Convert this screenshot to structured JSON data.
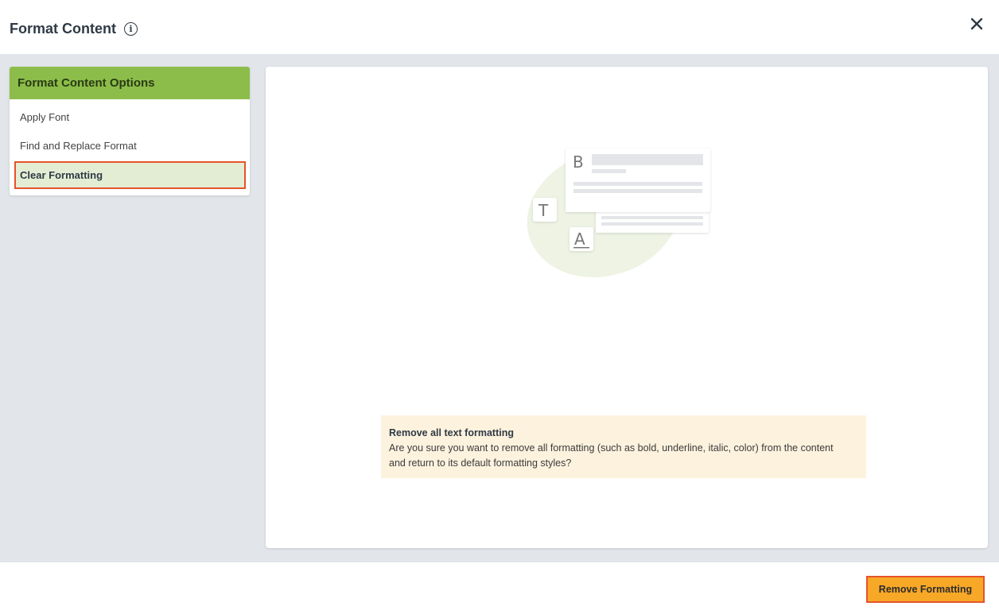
{
  "dialog": {
    "title": "Format Content",
    "info_icon": "info-circle-icon",
    "close_icon": "close-icon"
  },
  "sidebar": {
    "header": "Format Content Options",
    "items": [
      {
        "label": "Apply Font",
        "selected": false
      },
      {
        "label": "Find and Replace Format",
        "selected": false
      },
      {
        "label": "Clear Formatting",
        "selected": true
      }
    ]
  },
  "illustration": {
    "letters": [
      "B",
      "T",
      "A"
    ],
    "icon": "text-formatting-illustration"
  },
  "notice": {
    "title": "Remove all text formatting",
    "line1": "Are you sure you want to remove all formatting (such as bold, underline, italic, color) from the content",
    "line2": "and return to its default formatting styles?"
  },
  "footer": {
    "primary_button": "Remove Formatting"
  },
  "colors": {
    "accent_green": "#8cbd4a",
    "selected_bg": "#e3edd4",
    "highlight_border": "#e6532b",
    "primary_button": "#f7a827",
    "notice_bg": "#fdf2de",
    "canvas_bg": "#e2e5e9"
  }
}
